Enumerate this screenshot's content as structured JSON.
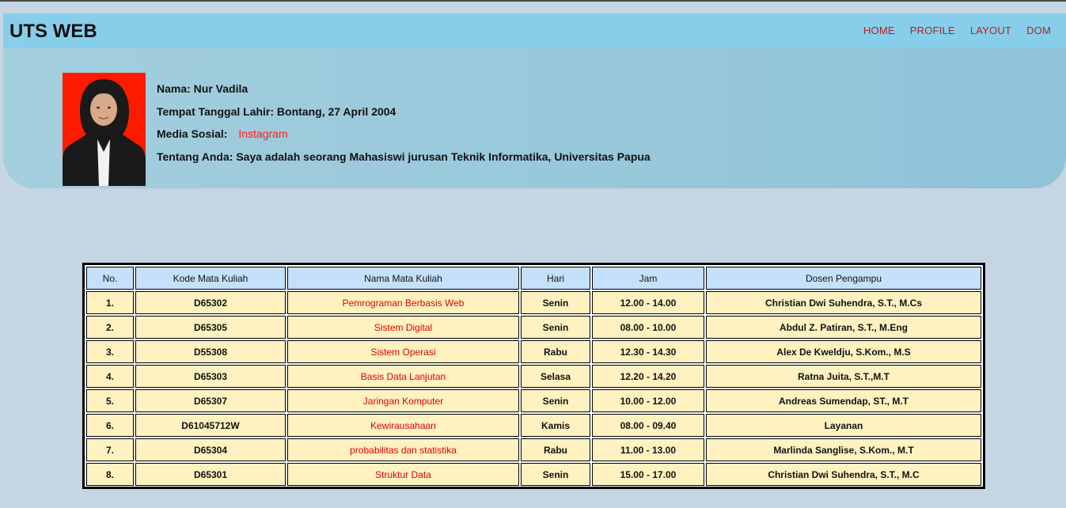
{
  "header": {
    "title": "UTS WEB",
    "nav": [
      "HOME",
      "PROFILE",
      "LAYOUT",
      "DOM"
    ]
  },
  "profile": {
    "name_label": "Nama: Nur Vadila",
    "birth_label": "Tempat Tanggal Lahir: Bontang, 27 April 2004",
    "social_label": "Media Sosial:",
    "social_link": "Instagram",
    "about_label": "Tentang Anda: Saya adalah seorang Mahasiswi jurusan Teknik Informatika, Universitas Papua"
  },
  "table": {
    "headers": [
      "No.",
      "Kode Mata Kuliah",
      "Nama Mata Kuliah",
      "Hari",
      "Jam",
      "Dosen Pengampu"
    ],
    "rows": [
      [
        "1.",
        "D65302",
        "Pemrograman Berbasis Web",
        "Senin",
        "12.00 - 14.00",
        "Christian Dwi Suhendra, S.T., M.Cs"
      ],
      [
        "2.",
        "D65305",
        "Sistem Digital",
        "Senin",
        "08.00 - 10.00",
        "Abdul Z. Patiran, S.T., M.Eng"
      ],
      [
        "3.",
        "D55308",
        "Sistem Operasi",
        "Rabu",
        "12.30 - 14.30",
        "Alex De Kweldju, S.Kom., M.S"
      ],
      [
        "4.",
        "D65303",
        "Basis Data Lanjutan",
        "Selasa",
        "12.20 - 14.20",
        "Ratna Juita, S.T.,M.T"
      ],
      [
        "5.",
        "D65307",
        "Jaringan Komputer",
        "Senin",
        "10.00 - 12.00",
        "Andreas Sumendap, ST., M.T"
      ],
      [
        "6.",
        "D61045712W",
        "Kewirausahaan",
        "Kamis",
        "08.00 - 09.40",
        "Layanan"
      ],
      [
        "7.",
        "D65304",
        "probabilitas dan statistika",
        "Rabu",
        "11.00 - 13.00",
        "Marlinda Sanglise, S.Kom., M.T"
      ],
      [
        "8.",
        "D65301",
        "Struktur Data",
        "Senin",
        "15.00 - 17.00",
        "Christian Dwi Suhendra, S.T., M.C"
      ]
    ]
  },
  "colors": {
    "navbar_bg": "#87ceeb",
    "nav_link": "#b22222",
    "link_red": "#ff1a1a",
    "header_cell": "#c5e0fb",
    "body_cell": "#fff2c0",
    "page_bg": "#c5d5e2"
  }
}
